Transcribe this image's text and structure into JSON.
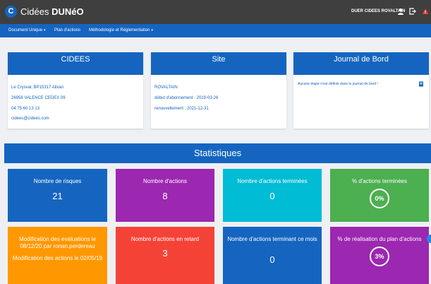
{
  "app": {
    "logo_letter": "C",
    "brand_prefix": "Cidées ",
    "brand_name": "DUNéO",
    "user_name": "DUER CIDEES ROVALTAIN",
    "icons": [
      "user-icon",
      "logout-icon",
      "alert-icon"
    ]
  },
  "nav": {
    "items": [
      {
        "label": "Document Unique",
        "caret": "▾"
      },
      {
        "label": "Plan d'actions",
        "caret": ""
      },
      {
        "label": "Méthodologie et Réglementation",
        "caret": "▾"
      }
    ]
  },
  "cards": {
    "cidees": {
      "title": "CIDEES",
      "lines": [
        "Le Crysval, BP15317 Alixan",
        "26958 VALENCE CEDEX 09",
        "04 75 60 13 13",
        "cidees@cidees.com"
      ]
    },
    "site": {
      "title": "Site",
      "lines": [
        "ROVALTAIN",
        "début d'abonnement : 2019-03-26",
        "renouvellement : 2021-12-31"
      ]
    },
    "journal": {
      "title": "Journal de Bord",
      "message": "Aucune étape n'est définie dans le journal de bord !"
    }
  },
  "stats": {
    "title": "Statistiques",
    "tiles": [
      {
        "title": "Nombre de risques",
        "value": "21",
        "color": "#1565c0"
      },
      {
        "title": "Nombre d'actions",
        "value": "8",
        "color": "#9c27b0"
      },
      {
        "title": "Nombre d'actions terminées",
        "value": "0",
        "color": "#00bcd4"
      },
      {
        "title": "% d'actions terminées",
        "value": "0%",
        "color": "#4caf50"
      },
      {
        "title": "Modification des evaluations le 08/12/20 par ronan.perdereau",
        "subtitle": "Modification des actions le 02/05/19",
        "color": "#ff9800"
      },
      {
        "title": "Nombre d'actions en retard",
        "value": "3",
        "color": "#f44336"
      },
      {
        "title": "Nombre d'actions terminant ce mois",
        "value": "0",
        "color": "#1565c0"
      },
      {
        "title": "% de réalisation du plan d'actions",
        "value": "3%",
        "color": "#9c27b0"
      }
    ]
  }
}
